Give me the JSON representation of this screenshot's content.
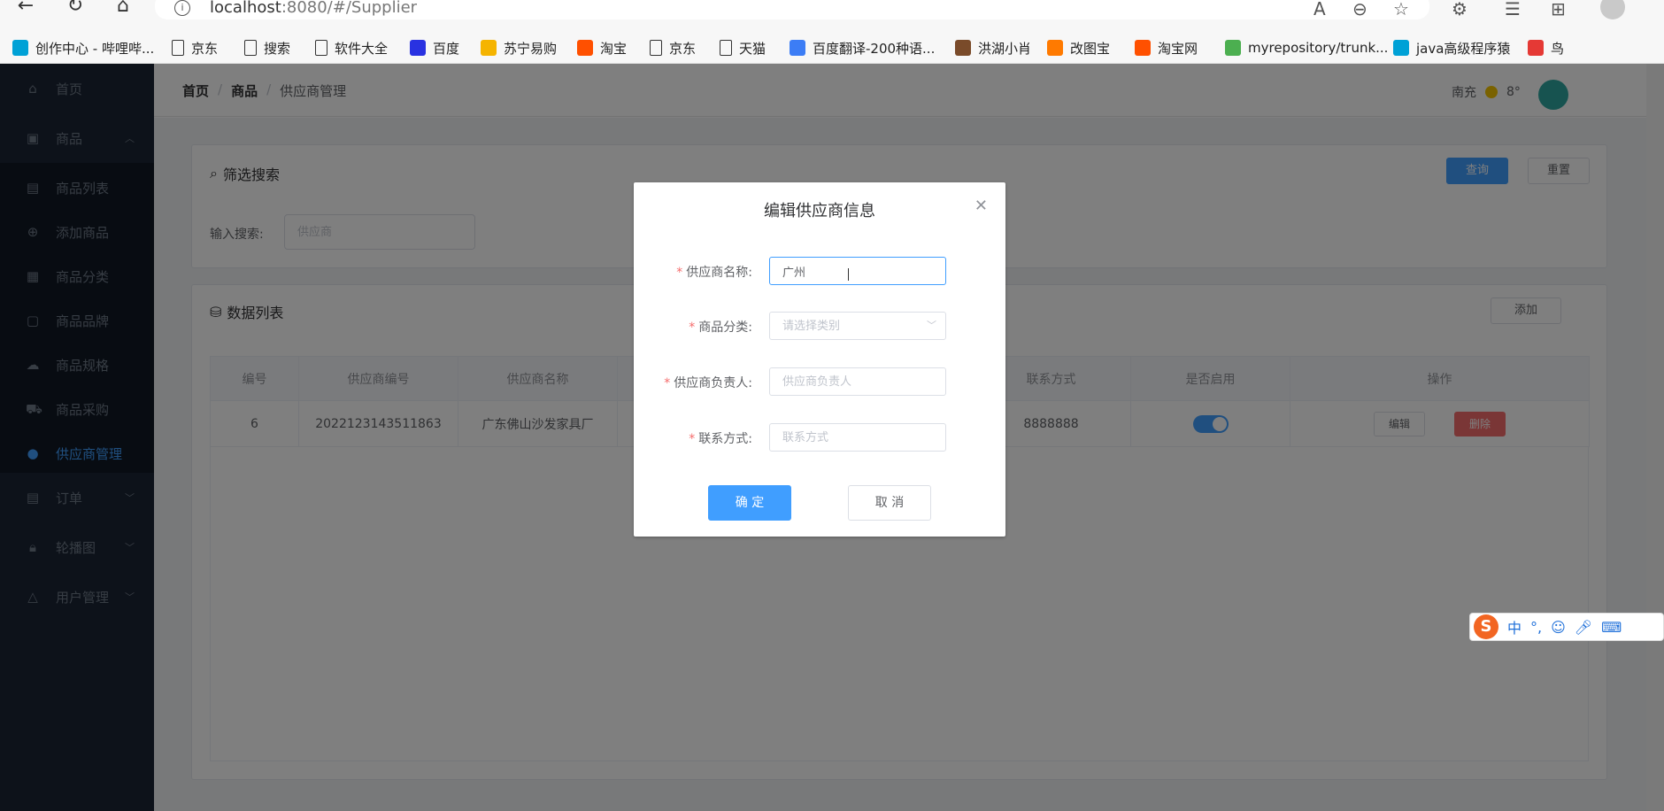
{
  "browser": {
    "url_host": "localhost",
    "url_rest": ":8080/#/Supplier",
    "bookmarks": [
      {
        "label": "创作中心 - 哔哩哔...",
        "color": "#00a1d6"
      },
      {
        "label": "京东",
        "color": ""
      },
      {
        "label": "搜索",
        "color": ""
      },
      {
        "label": "软件大全",
        "color": ""
      },
      {
        "label": "百度",
        "color": "#2932e1"
      },
      {
        "label": "苏宁易购",
        "color": "#f5b400"
      },
      {
        "label": "淘宝",
        "color": "#ff5000"
      },
      {
        "label": "京东",
        "color": ""
      },
      {
        "label": "天猫",
        "color": ""
      },
      {
        "label": "百度翻译-200种语...",
        "color": "#3c7df5"
      },
      {
        "label": "洪湖小肖",
        "color": "#7a4b2a"
      },
      {
        "label": "改图宝",
        "color": "#ff7a00"
      },
      {
        "label": "淘宝网",
        "color": "#ff5000"
      },
      {
        "label": "myrepository/trunk...",
        "color": "#4caf50"
      },
      {
        "label": "java高级程序猿",
        "color": "#00a1d6"
      },
      {
        "label": "鸟",
        "color": "#e53935"
      }
    ]
  },
  "sidebar": {
    "items": [
      {
        "label": "首页",
        "icon": "home-icon"
      },
      {
        "label": "商品",
        "icon": "goods-icon"
      },
      {
        "label": "商品列表",
        "icon": "list-icon"
      },
      {
        "label": "添加商品",
        "icon": "plus-circle-icon"
      },
      {
        "label": "商品分类",
        "icon": "grid-icon"
      },
      {
        "label": "商品品牌",
        "icon": "brand-icon"
      },
      {
        "label": "商品规格",
        "icon": "cloud-icon"
      },
      {
        "label": "商品采购",
        "icon": "truck-icon"
      },
      {
        "label": "供应商管理",
        "icon": "user-icon"
      },
      {
        "label": "订单",
        "icon": "order-icon"
      },
      {
        "label": "轮播图",
        "icon": "lock-icon"
      },
      {
        "label": "用户管理",
        "icon": "bell-icon"
      }
    ]
  },
  "header": {
    "breadcrumb": [
      "首页",
      "商品",
      "供应商管理"
    ],
    "weather_city": "南充",
    "weather_temp": "8°"
  },
  "filter": {
    "title": "筛选搜索",
    "query_btn": "查询",
    "reset_btn": "重置",
    "search_label": "输入搜索:",
    "search_placeholder": "供应商"
  },
  "datalist": {
    "title": "数据列表",
    "add_btn": "添加",
    "columns": [
      "编号",
      "供应商编号",
      "供应商名称",
      "",
      "",
      "联系方式",
      "是否启用",
      "操作"
    ],
    "rows": [
      {
        "id": "6",
        "code": "2022123143511863",
        "name": "广东佛山沙发家具厂",
        "phone": "8888888",
        "edit": "编辑",
        "delete": "删除"
      }
    ]
  },
  "dialog": {
    "title": "编辑供应商信息",
    "name_label": "供应商名称:",
    "name_value": "广州",
    "category_label": "商品分类:",
    "category_placeholder": "请选择类别",
    "contact_label": "供应商负责人:",
    "contact_placeholder": "供应商负责人",
    "phone_label": "联系方式:",
    "phone_placeholder": "联系方式",
    "ok_btn": "确 定",
    "cancel_btn": "取 消"
  },
  "ime": {
    "logo": "S",
    "mode": "中"
  },
  "colors": {
    "primary": "#409eff",
    "danger": "#f56c6c",
    "sidebar_bg": "#1a2434"
  }
}
